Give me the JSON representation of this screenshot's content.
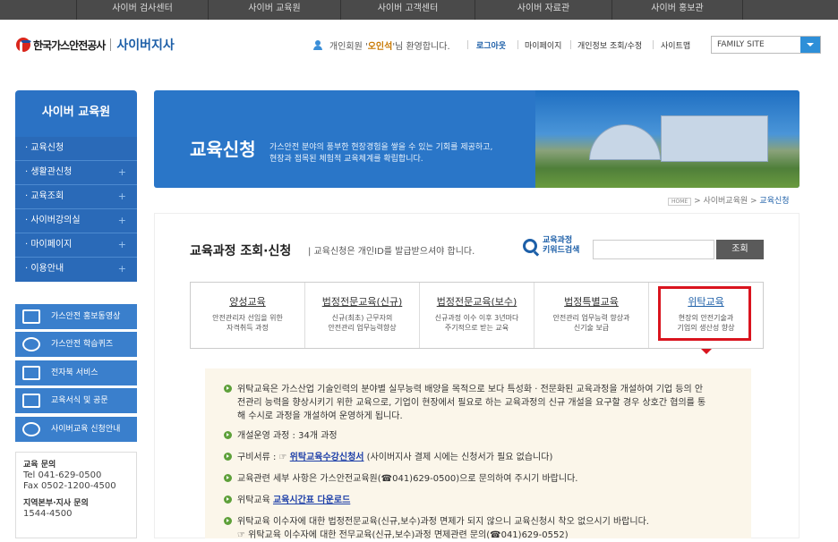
{
  "topnav": [
    "사이버 검사센터",
    "사이버 교육원",
    "사이버 고객센터",
    "사이버 자료관",
    "사이버 홍보관"
  ],
  "header": {
    "logo_company": "한국가스안전공사",
    "logo_sub": "사이버지사",
    "welcome_prefix": "개인회원 '",
    "welcome_name": "오인석",
    "welcome_suffix": "'님 환영합니다.",
    "logout": "로그아웃",
    "mypage": "마이페이지",
    "privacy": "개인정보 조회/수정",
    "sitemap": "사이트맵",
    "family_site": "FAMILY SITE"
  },
  "sidebar": {
    "title": "사이버 교육원",
    "items": [
      {
        "label": "교육신청"
      },
      {
        "label": "생활관신청"
      },
      {
        "label": "교육조회"
      },
      {
        "label": "사이버강의실"
      },
      {
        "label": "마이페이지"
      },
      {
        "label": "이용안내"
      }
    ],
    "buttons": [
      "가스안전 홍보동영상",
      "가스안전 학습퀴즈",
      "전자북 서비스",
      "교육서식 및 공문",
      "사이버교육 신청안내"
    ],
    "contact": {
      "edu_label": "교육 문의",
      "tel": "Tel 041-629-0500",
      "fax": "Fax 0502-1200-4500",
      "branch_label": "지역본부·지사 문의",
      "branch_phone": "1544-4500"
    }
  },
  "banner": {
    "title": "교육신청",
    "desc1": "가스안전 분야의 풍부한 현장경험을 쌓을 수 있는 기회를 제공하고,",
    "desc2": "현장과 접목된 체험적 교육체계를 확립합니다."
  },
  "breadcrumb": {
    "home": "HOME",
    "level1": "사이버교육원",
    "current": "교육신청"
  },
  "page": {
    "title": "교육과정 조회·신청",
    "subtitle": "| 교육신청은 개인ID를 발급받으셔야 합니다.",
    "keyword_label1": "교육과정",
    "keyword_label2": "키워드검색",
    "search_button": "조회"
  },
  "tabs": [
    {
      "title": "양성교육",
      "desc1": "안전관리자 선임을 위한",
      "desc2": "자격취득 과정"
    },
    {
      "title": "법정전문교육(신규)",
      "desc1": "신규(최초) 근무자의",
      "desc2": "안전관리 업무능력향상"
    },
    {
      "title": "법정전문교육(보수)",
      "desc1": "신규과정 이수 이후 3년마다",
      "desc2": "주기적으로 받는 교육"
    },
    {
      "title": "법정특별교육",
      "desc1": "안전관리 업무능력 향상과",
      "desc2": "신기술 보급"
    },
    {
      "title": "위탁교육",
      "desc1": "현장의 안전기술과",
      "desc2": "기업의 생산성 향상"
    }
  ],
  "content": {
    "p1_l1": "위탁교육은 가스산업 기술인력의 분야별 실무능력 배양을 목적으로 보다 특성화 · 전문화된 교육과정을 개설하여 기업 등의 안",
    "p1_l2": "전관리 능력을 향상시키기 위한 교육으로, 기업이 현장에서 필요로 하는 교육과정의 신규 개설을 요구할 경우 상호간 협의를 통",
    "p1_l3": "해 수시로 과정을 개설하여 운영하게 됩니다.",
    "p2": "개설운영 과정 : 34개 과정",
    "p3_prefix": "구비서류 : ☞ ",
    "p3_link": "위탁교육수강신청서",
    "p3_suffix": " (사이버지사 결제 시에는 신청서가 필요 없습니다)",
    "p4": "교육관련 세부 사항은 가스안전교육원(☎041)629-0500)으로 문의하여 주시기 바랍니다.",
    "p5_prefix": "위탁교육 ",
    "p5_link": "교육시간표 다운로드",
    "p6_l1": "위탁교육 이수자에 대한 법정전문교육(신규,보수)과정 면제가 되지 않으니 교육신청시 착오 없으시기 바랍니다.",
    "p6_l2": "☞ 위탁교육 이수자에 대한 전무교육(신규,보수)과정 면제관련 문의(☎041)629-0552)"
  },
  "colors": {
    "primary": "#2b72c4",
    "accent_red": "#d9141e",
    "link": "#1d3fa8"
  }
}
